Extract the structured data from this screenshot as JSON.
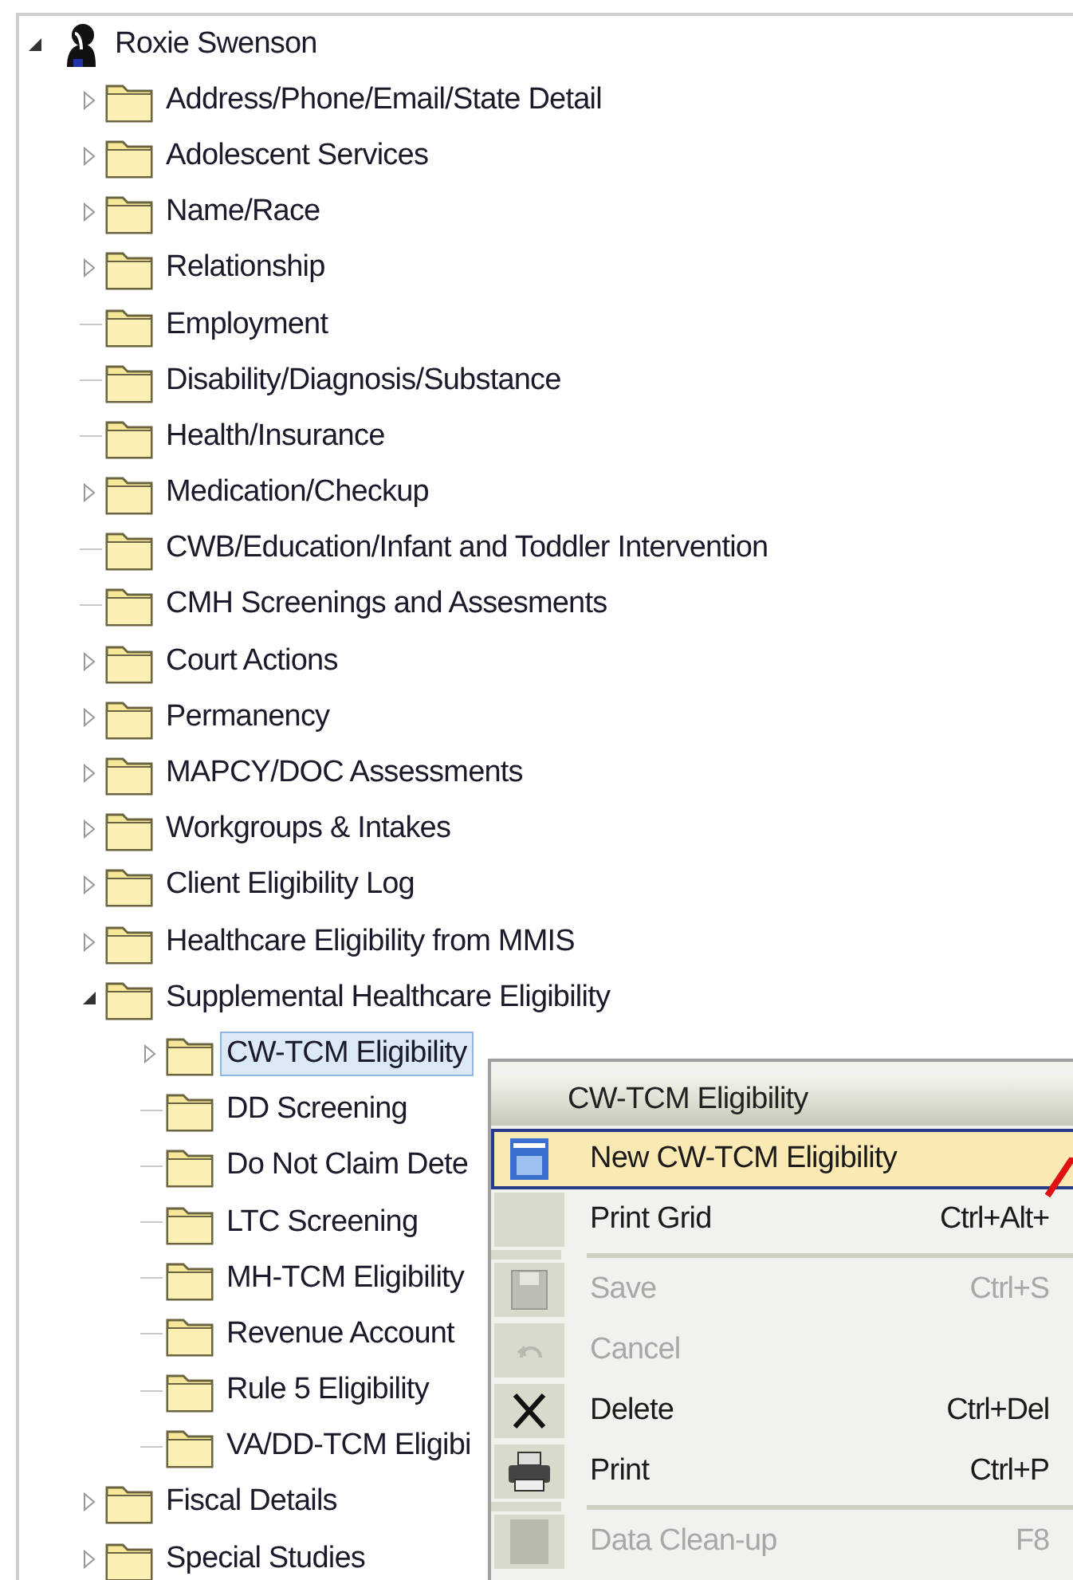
{
  "tree": {
    "label": "Roxie Swenson",
    "expanded": true,
    "selected": false,
    "children": [
      {
        "label": "Address/Phone/Email/State Detail",
        "kind": "branch",
        "expanded": false,
        "selected": false
      },
      {
        "label": "Adolescent Services",
        "kind": "branch",
        "expanded": false,
        "selected": false
      },
      {
        "label": "Name/Race",
        "kind": "branch",
        "expanded": false,
        "selected": false
      },
      {
        "label": "Relationship",
        "kind": "branch",
        "expanded": false,
        "selected": false
      },
      {
        "label": "Employment",
        "kind": "leaf",
        "selected": false
      },
      {
        "label": "Disability/Diagnosis/Substance",
        "kind": "leaf",
        "selected": false
      },
      {
        "label": "Health/Insurance",
        "kind": "leaf",
        "selected": false
      },
      {
        "label": "Medication/Checkup",
        "kind": "branch",
        "expanded": false,
        "selected": false
      },
      {
        "label": "CWB/Education/Infant and Toddler Intervention",
        "kind": "leaf",
        "selected": false
      },
      {
        "label": "CMH Screenings and Assesments",
        "kind": "leaf",
        "selected": false
      },
      {
        "label": "Court Actions",
        "kind": "branch",
        "expanded": false,
        "selected": false
      },
      {
        "label": "Permanency",
        "kind": "branch",
        "expanded": false,
        "selected": false
      },
      {
        "label": "MAPCY/DOC Assessments",
        "kind": "branch",
        "expanded": false,
        "selected": false
      },
      {
        "label": "Workgroups & Intakes",
        "kind": "branch",
        "expanded": false,
        "selected": false
      },
      {
        "label": "Client Eligibility Log",
        "kind": "branch",
        "expanded": false,
        "selected": false
      },
      {
        "label": "Healthcare Eligibility from MMIS",
        "kind": "branch",
        "expanded": false,
        "selected": false
      },
      {
        "label": "Supplemental Healthcare Eligibility",
        "kind": "branch",
        "expanded": true,
        "selected": false,
        "children": [
          {
            "label": "CW-TCM Eligibility",
            "kind": "branch",
            "expanded": false,
            "selected": true
          },
          {
            "label": "DD Screening",
            "kind": "leaf",
            "selected": false
          },
          {
            "label": "Do Not Claim Dete",
            "kind": "leaf",
            "selected": false
          },
          {
            "label": "LTC Screening",
            "kind": "leaf",
            "selected": false
          },
          {
            "label": "MH-TCM Eligibility",
            "kind": "leaf",
            "selected": false
          },
          {
            "label": "Revenue Account",
            "kind": "leaf",
            "selected": false
          },
          {
            "label": "Rule 5 Eligibility",
            "kind": "leaf",
            "selected": false
          },
          {
            "label": "VA/DD-TCM Eligibi",
            "kind": "leaf",
            "selected": false
          }
        ]
      },
      {
        "label": "Fiscal Details",
        "kind": "branch",
        "expanded": false,
        "selected": false
      },
      {
        "label": "Special Studies",
        "kind": "branch",
        "expanded": false,
        "selected": false
      }
    ]
  },
  "context_menu": {
    "title": "CW-TCM Eligibility",
    "items": [
      {
        "kind": "item",
        "label": "New CW-TCM Eligibility",
        "disabled": false,
        "selected": true
      },
      {
        "kind": "item",
        "label": "Print Grid",
        "shortcut": "Ctrl+Alt+",
        "disabled": false,
        "selected": false
      },
      {
        "kind": "separator"
      },
      {
        "kind": "item",
        "label": "Save",
        "shortcut": "Ctrl+S",
        "disabled": true,
        "selected": false
      },
      {
        "kind": "item",
        "label": "Cancel",
        "disabled": true,
        "selected": false
      },
      {
        "kind": "item",
        "label": "Delete",
        "shortcut": "Ctrl+Del",
        "disabled": false,
        "selected": false
      },
      {
        "kind": "item",
        "label": "Print",
        "shortcut": "Ctrl+P",
        "disabled": false,
        "selected": false
      },
      {
        "kind": "separator"
      },
      {
        "kind": "item",
        "label": "Data Clean-up",
        "shortcut": "F8",
        "disabled": true,
        "selected": false
      }
    ]
  }
}
